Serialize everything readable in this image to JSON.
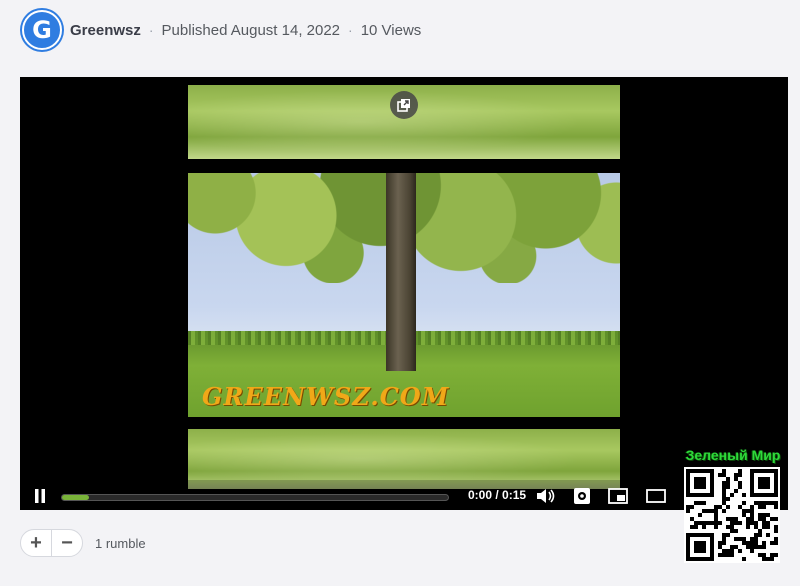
{
  "header": {
    "avatar_letter": "G",
    "channel_name": "Greenwsz",
    "published": "Published August 14, 2022",
    "views": "10 Views"
  },
  "player": {
    "watermark": "GREENWSZ.COM",
    "time_display": "0:00 / 0:15",
    "progress": 0.07,
    "icons": [
      "popout-icon",
      "pause-icon",
      "volume-icon",
      "settings-icon",
      "pip-icon",
      "theater-icon"
    ]
  },
  "rumble": {
    "plus_label": "+",
    "minus_label": "−",
    "count": "1 rumble"
  },
  "overlay": {
    "label": "Зеленый Мир"
  },
  "colors": {
    "accent": "#79b339",
    "avatar": "#2f7de1",
    "overlay_text": "#2eda3a"
  }
}
